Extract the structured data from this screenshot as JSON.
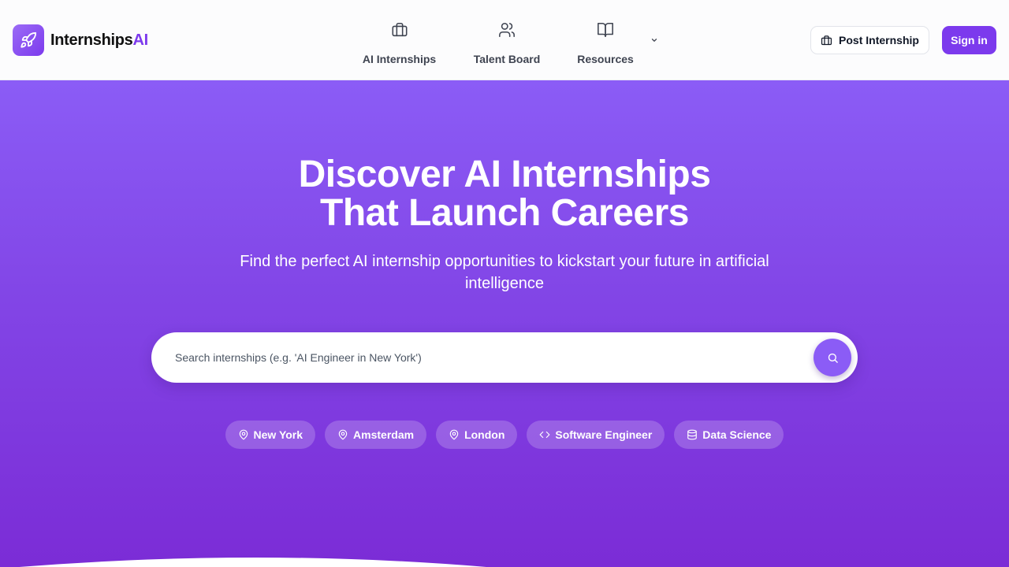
{
  "brand": {
    "name": "Internships",
    "accent": "AI",
    "accent_color": "#7c3aed",
    "icon": "rocket-icon"
  },
  "nav": [
    {
      "label": "AI Internships",
      "icon": "briefcase-icon"
    },
    {
      "label": "Talent Board",
      "icon": "users-icon"
    },
    {
      "label": "Resources",
      "icon": "book-open-icon"
    }
  ],
  "nav_more_icon": "chevron-down-icon",
  "actions": {
    "post_label": "Post Internship",
    "post_icon": "briefcase-icon",
    "signin_label": "Sign in"
  },
  "hero": {
    "title_line1": "Discover AI Internships",
    "title_line2": "That Launch Careers",
    "subtitle": "Find the perfect AI internship opportunities to kickstart your future in artificial intelligence",
    "gradient_top": "#8b5cf6",
    "gradient_bottom": "#7b2cd6"
  },
  "search": {
    "placeholder": "Search internships (e.g. 'AI Engineer in New York')",
    "value": "",
    "button_icon": "search-icon"
  },
  "chips": [
    {
      "label": "New York",
      "icon": "map-pin-icon"
    },
    {
      "label": "Amsterdam",
      "icon": "map-pin-icon"
    },
    {
      "label": "London",
      "icon": "map-pin-icon"
    },
    {
      "label": "Software Engineer",
      "icon": "code-icon"
    },
    {
      "label": "Data Science",
      "icon": "database-icon"
    }
  ]
}
